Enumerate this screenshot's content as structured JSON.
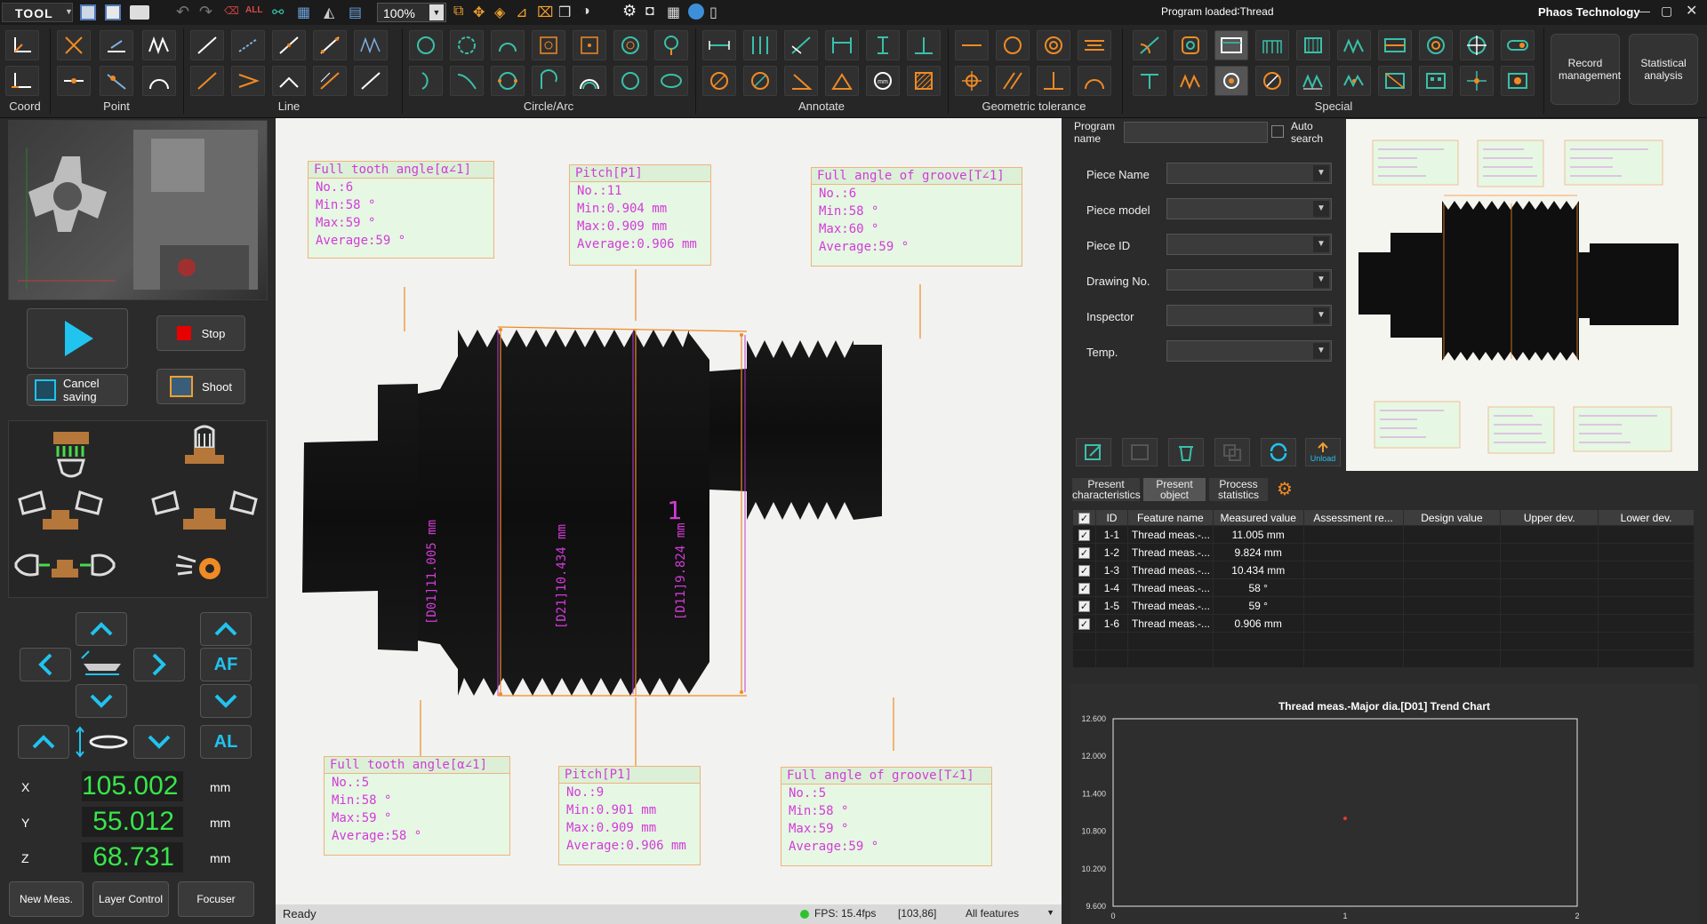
{
  "title_bar": {
    "tool_label": "TOOL",
    "zoom": "100%",
    "program_loaded": "Program  loaded∶Thread",
    "company": "Phaos Technology"
  },
  "ribbon": {
    "groups": [
      "Coord",
      "Point",
      "Line",
      "Circle/Arc",
      "Annotate",
      "Geometric tolerance",
      "Special"
    ],
    "record_management": "Record management",
    "statistical_analysis": "Statistical analysis"
  },
  "left_panel": {
    "stop": "Stop",
    "cancel_saving": "Cancel saving",
    "shoot": "Shoot",
    "af": "AF",
    "al": "AL",
    "coords": [
      {
        "axis": "X",
        "value": "105.002",
        "unit": "mm"
      },
      {
        "axis": "Y",
        "value": "55.012",
        "unit": "mm"
      },
      {
        "axis": "Z",
        "value": "68.731",
        "unit": "mm"
      }
    ],
    "new_meas": "New Meas.",
    "layer_control": "Layer Control",
    "focuser": "Focuser"
  },
  "view": {
    "labels": [
      {
        "title": "Full tooth angle[α∠1]",
        "rows": [
          "No.:6",
          "Min:58 °",
          "Max:59 °",
          "Average:59 °"
        ]
      },
      {
        "title": "Pitch[P1]",
        "rows": [
          "No.:11",
          "Min:0.904 mm",
          "Max:0.909 mm",
          "Average:0.906 mm"
        ]
      },
      {
        "title": "Full angle of groove[T∠1]",
        "rows": [
          "No.:6",
          "Min:58 °",
          "Max:60 °",
          "Average:59 °"
        ]
      },
      {
        "title": "Full tooth angle[α∠1]",
        "rows": [
          "No.:5",
          "Min:58 °",
          "Max:59 °",
          "Average:58 °"
        ]
      },
      {
        "title": "Pitch[P1]",
        "rows": [
          "No.:9",
          "Min:0.901 mm",
          "Max:0.909 mm",
          "Average:0.906 mm"
        ]
      },
      {
        "title": "Full angle of groove[T∠1]",
        "rows": [
          "No.:5",
          "Min:58 °",
          "Max:59 °",
          "Average:59 °"
        ]
      }
    ],
    "dim_d01": "[D01]11.005 mm",
    "dim_d21": "[D21]10.434 mm",
    "dim_d11": "[D11]9.824 mm",
    "center_label": "1"
  },
  "status_bar": {
    "state": "Ready",
    "fps": "FPS: 15.4fps",
    "cursor": "[103,86]",
    "filter": "All features"
  },
  "program_form": {
    "program_name_label": "Program name",
    "auto_search": "Auto search",
    "fields": [
      "Piece Name",
      "Piece model",
      "Piece ID",
      "Drawing No.",
      "Inspector",
      "Temp."
    ],
    "unload": "Unload"
  },
  "tabs": [
    "Present characteristics",
    "Present object",
    "Process statistics"
  ],
  "results_table": {
    "columns": [
      "ID",
      "Feature name",
      "Measured value",
      "Assessment re...",
      "Design value",
      "Upper dev.",
      "Lower dev."
    ],
    "rows": [
      {
        "id": "1-1",
        "name": "Thread meas.-...",
        "value": "11.005 mm"
      },
      {
        "id": "1-2",
        "name": "Thread meas.-...",
        "value": "9.824 mm"
      },
      {
        "id": "1-3",
        "name": "Thread meas.-...",
        "value": "10.434 mm"
      },
      {
        "id": "1-4",
        "name": "Thread meas.-...",
        "value": "58 °"
      },
      {
        "id": "1-5",
        "name": "Thread meas.-...",
        "value": "59 °"
      },
      {
        "id": "1-6",
        "name": "Thread meas.-...",
        "value": "0.906 mm"
      }
    ]
  },
  "chart_data": {
    "type": "scatter",
    "title": "Thread meas.-Major dia.[D01] Trend Chart",
    "x_ticks": [
      "0",
      "1",
      "2"
    ],
    "y_ticks": [
      "12.600",
      "12.000",
      "11.400",
      "10.800",
      "10.200",
      "9.600"
    ],
    "xlim": [
      0,
      2
    ],
    "ylim": [
      9.6,
      12.6
    ],
    "points": [
      {
        "x": 1,
        "y": 11.005
      }
    ],
    "point_color": "#e53c2a"
  }
}
